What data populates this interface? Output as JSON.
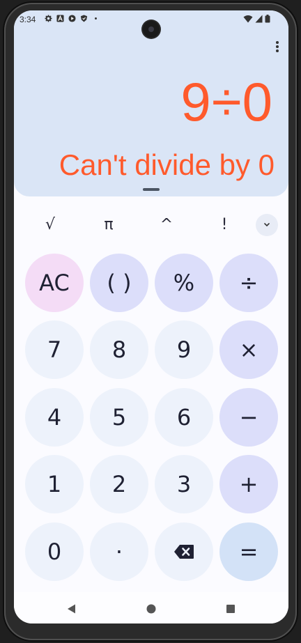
{
  "status_bar": {
    "time": "3:34",
    "left_icons": [
      "gear-icon",
      "a-icon",
      "play-icon",
      "shield-icon",
      "dot-icon"
    ],
    "right_icons": [
      "wifi-icon",
      "signal-icon",
      "battery-icon"
    ]
  },
  "display": {
    "expression": "9÷0",
    "result": "Can't divide by 0",
    "text_color": "#ff5a2c",
    "background": "#dae5f6"
  },
  "scientific": {
    "buttons": [
      "√",
      "π",
      "^",
      "!"
    ],
    "expand_icon": "chevron-down-icon"
  },
  "keypad": {
    "rows": [
      [
        "AC",
        "( )",
        "%",
        "÷"
      ],
      [
        "7",
        "8",
        "9",
        "×"
      ],
      [
        "4",
        "5",
        "6",
        "−"
      ],
      [
        "1",
        "2",
        "3",
        "+"
      ],
      [
        "0",
        "·",
        "backspace-icon",
        "="
      ]
    ]
  },
  "nav_bar": {
    "buttons": [
      "back-icon",
      "home-icon",
      "recents-icon"
    ]
  }
}
